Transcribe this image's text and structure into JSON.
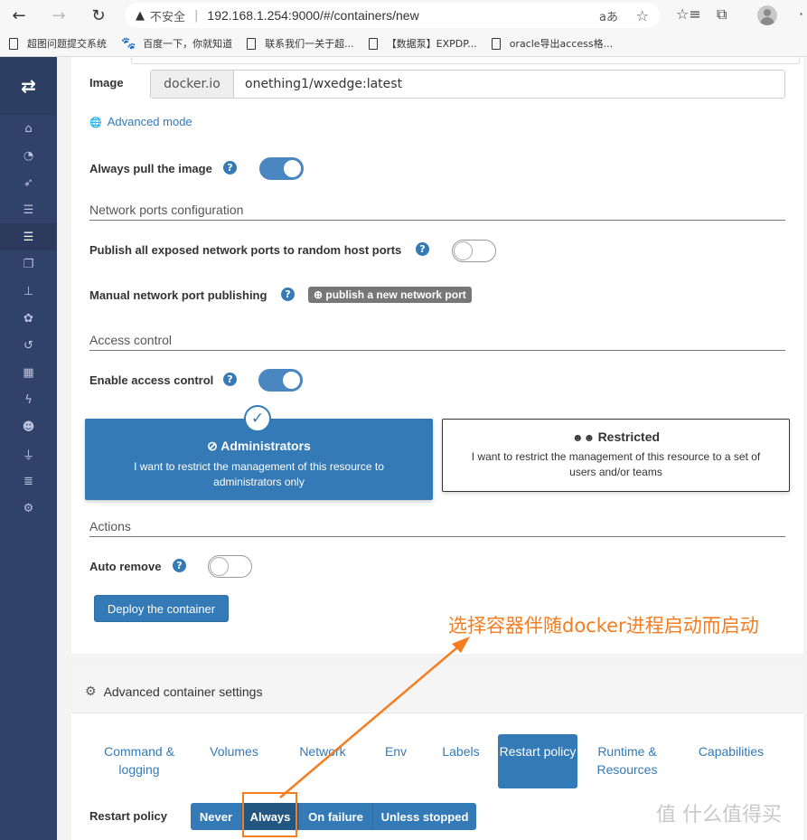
{
  "browser": {
    "back_icon": "←",
    "forward_icon": "→",
    "reload_icon": "↻",
    "security_icon": "▲",
    "security_label": "不安全",
    "url": "192.168.1.254:9000/#/containers/new",
    "read_aloud_icon": "aあ",
    "favorite_add_icon": "☆",
    "favorites_icon": "☆≡",
    "collections_icon": "⧉",
    "more_icon": "·",
    "bookmarks": [
      {
        "icon": "page-icon",
        "label": "超图问题提交系统"
      },
      {
        "icon": "baidu-paw-icon",
        "label": "百度一下，你就知道"
      },
      {
        "icon": "page-icon",
        "label": "联系我们一关于超..."
      },
      {
        "icon": "page-icon",
        "label": "【数据泵】EXPDP..."
      },
      {
        "icon": "page-icon",
        "label": "oracle导出access格..."
      }
    ]
  },
  "sidebar": {
    "logo": "⇄",
    "items": [
      {
        "name": "home",
        "glyph": "⌂",
        "active": false
      },
      {
        "name": "dashboard",
        "glyph": "◔",
        "active": false
      },
      {
        "name": "app-templates",
        "glyph": "➶",
        "active": false
      },
      {
        "name": "stacks",
        "glyph": "☰",
        "active": false
      },
      {
        "name": "containers",
        "glyph": "☰",
        "active": true
      },
      {
        "name": "images",
        "glyph": "❐",
        "active": false
      },
      {
        "name": "networks",
        "glyph": "⊥",
        "active": false
      },
      {
        "name": "volumes",
        "glyph": "✿",
        "active": false
      },
      {
        "name": "events",
        "glyph": "↺",
        "active": false
      },
      {
        "name": "host",
        "glyph": "▦",
        "active": false
      },
      {
        "name": "extensions",
        "glyph": "ϟ",
        "active": false
      },
      {
        "name": "users",
        "glyph": "☻",
        "active": false
      },
      {
        "name": "endpoints",
        "glyph": "⏚",
        "active": false
      },
      {
        "name": "registries",
        "glyph": "≣",
        "active": false
      },
      {
        "name": "settings",
        "glyph": "⚙",
        "active": false
      }
    ]
  },
  "form": {
    "image": {
      "label": "Image",
      "registry": "docker.io",
      "value": "onething1/wxedge:latest"
    },
    "advanced_mode": {
      "icon": "globe-icon",
      "label": "Advanced mode"
    },
    "always_pull": {
      "label": "Always pull the image",
      "enabled": true
    },
    "network_section": "Network ports configuration",
    "publish_all": {
      "label": "Publish all exposed network ports to random host ports",
      "enabled": false
    },
    "manual_publish": {
      "label": "Manual network port publishing",
      "button": "publish a new network port"
    },
    "access_section": "Access control",
    "enable_access": {
      "label": "Enable access control",
      "enabled": true
    },
    "access_options": [
      {
        "title": "Administrators",
        "description": "I want to restrict the management of this resource to administrators only",
        "selected": true
      },
      {
        "title": "Restricted",
        "description": "I want to restrict the management of this resource to a set of users and/or teams",
        "selected": false
      }
    ],
    "actions_section": "Actions",
    "auto_remove": {
      "label": "Auto remove",
      "enabled": false
    },
    "deploy_button": "Deploy the container",
    "help_glyph": "?"
  },
  "advanced": {
    "title": "Advanced container settings",
    "tabs": [
      {
        "label": "Command & logging",
        "active": false
      },
      {
        "label": "Volumes",
        "active": false
      },
      {
        "label": "Network",
        "active": false
      },
      {
        "label": "Env",
        "active": false
      },
      {
        "label": "Labels",
        "active": false
      },
      {
        "label": "Restart policy",
        "active": true
      },
      {
        "label": "Runtime & Resources",
        "active": false
      },
      {
        "label": "Capabilities",
        "active": false
      }
    ],
    "restart_policy": {
      "label": "Restart policy",
      "options": [
        "Never",
        "Always",
        "On failure",
        "Unless stopped"
      ],
      "selected": "Always"
    }
  },
  "annotation": {
    "text": "选择容器伴随docker进程启动而启动",
    "color": "#f57c1f"
  },
  "watermark": "值 什么值得买",
  "colors": {
    "primary": "#337ab7",
    "sidebar": "#30426a",
    "annotation": "#f57c1f"
  }
}
